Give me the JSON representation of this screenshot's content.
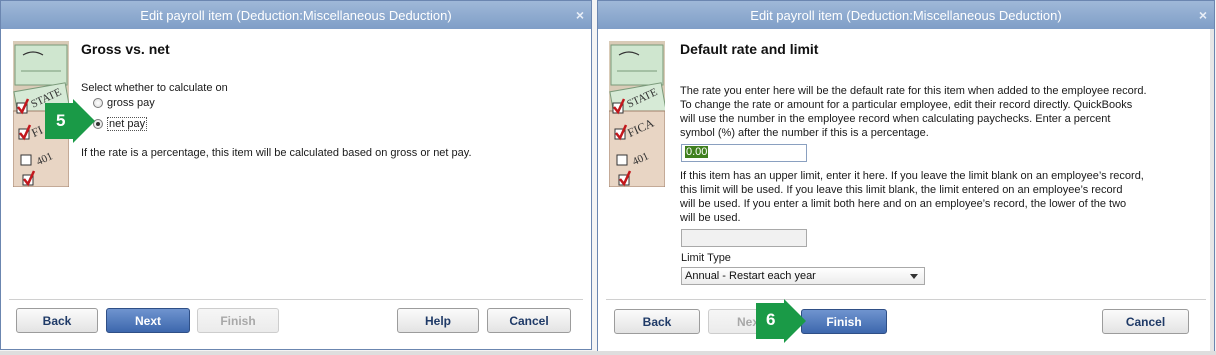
{
  "left_dialog": {
    "title": "Edit payroll item (Deduction:Miscellaneous Deduction)",
    "heading": "Gross vs. net",
    "prompt": "Select whether to calculate on",
    "options": [
      {
        "label": "gross pay",
        "selected": false
      },
      {
        "label": "net pay",
        "selected": true
      }
    ],
    "note": "If the rate is a percentage, this item will be calculated based on gross or net pay.",
    "callout": "5",
    "buttons": {
      "back": "Back",
      "next": "Next",
      "finish": "Finish",
      "help": "Help",
      "cancel": "Cancel"
    }
  },
  "right_dialog": {
    "title": "Edit payroll item (Deduction:Miscellaneous Deduction)",
    "heading": "Default rate and limit",
    "rate_description": [
      "The rate you enter here will be the default rate for this item when added to the employee record.",
      "To change the rate or amount for a particular employee, edit their record directly.  QuickBooks",
      "will use the number in the employee record when calculating paychecks.  Enter a percent",
      "symbol (%) after the number if this is a percentage."
    ],
    "rate_value": "0.00",
    "limit_description": [
      "If this item has an upper limit, enter it here. If you leave the limit blank on an employee’s record,",
      "this limit will be used.  If you leave this limit blank, the limit entered on an employee’s record",
      "will be used.  If you enter a limit both here and on an employee’s  record, the lower of the two",
      "will be used."
    ],
    "limit_value": "",
    "limit_type_label": "Limit Type",
    "limit_type_value": "Annual - Restart each year",
    "callout": "6",
    "buttons": {
      "back": "Back",
      "next": "Next",
      "finish": "Finish",
      "cancel": "Cancel"
    }
  },
  "colors": {
    "titlebar": "#8aa7cf",
    "primary_button": "#4a72b5",
    "callout_green": "#1a9a47",
    "selected_value": "#3f7f1e"
  }
}
